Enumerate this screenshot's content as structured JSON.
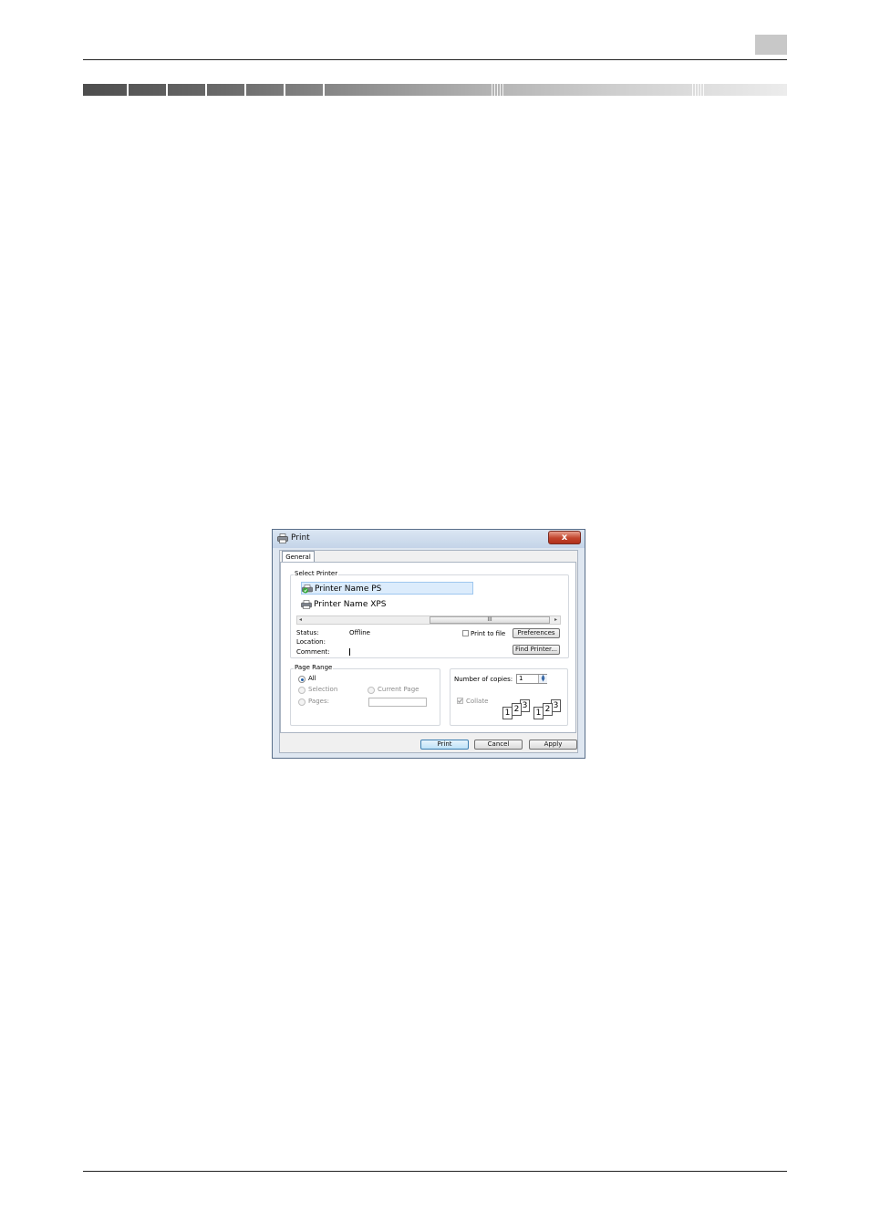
{
  "dialog": {
    "title": "Print",
    "close_label": "x",
    "tab": "General",
    "select_printer": {
      "legend": "Select Printer",
      "printers": [
        {
          "name": "Printer Name PS",
          "selected": true
        },
        {
          "name": "Printer Name XPS",
          "selected": false
        }
      ],
      "scroll_thumb_label": "III",
      "scroll_left": "◂",
      "scroll_right": "▸",
      "status_label": "Status:",
      "status_value": "Offline",
      "location_label": "Location:",
      "comment_label": "Comment:",
      "print_to_file_label": "Print to file",
      "preferences_button": "Preferences",
      "find_printer_button": "Find Printer..."
    },
    "page_range": {
      "legend": "Page Range",
      "all_label": "All",
      "selection_label": "Selection",
      "current_page_label": "Current Page",
      "pages_label": "Pages:"
    },
    "copies": {
      "number_label": "Number of copies:",
      "value": "1",
      "collate_label": "Collate",
      "collate_sheets": [
        "1",
        "2",
        "3",
        "1",
        "2",
        "3"
      ]
    },
    "buttons": {
      "print": "Print",
      "cancel": "Cancel",
      "apply": "Apply"
    }
  }
}
